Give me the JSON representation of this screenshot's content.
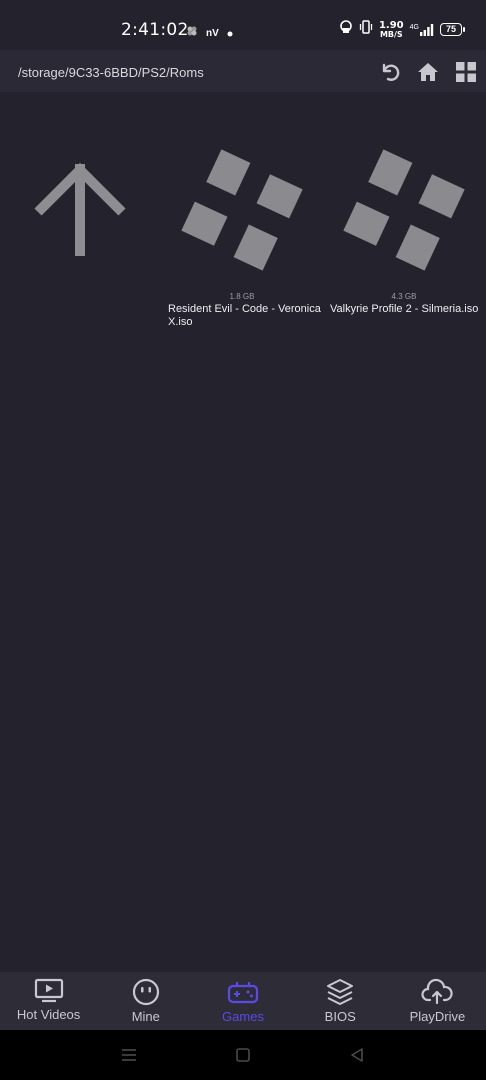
{
  "status_bar": {
    "time": "2:41:02",
    "carrier_text": "nV",
    "net_speed_value": "1.90",
    "net_speed_unit": "MB/S",
    "network_type": "4G",
    "battery": "75"
  },
  "path_header": {
    "path": "/storage/9C33-6BBD/PS2/Roms",
    "icons": [
      "back-arrow-icon",
      "home-icon",
      "grid-view-icon"
    ]
  },
  "files": [
    {
      "type": "parent-directory",
      "icon": "up-arrow-icon",
      "size": "",
      "name": ""
    },
    {
      "type": "game",
      "icon": "gamepad-dpad-icon",
      "size": "1.8 GB",
      "name": "Resident Evil - Code - Veronica X.iso"
    },
    {
      "type": "game",
      "icon": "gamepad-dpad-icon",
      "size": "4.3 GB",
      "name": "Valkyrie Profile 2 - Silmeria.iso"
    }
  ],
  "bottom_nav": {
    "items": [
      {
        "label": "Hot Videos",
        "icon": "video-tv-icon",
        "active": false
      },
      {
        "label": "Mine",
        "icon": "face-icon",
        "active": false
      },
      {
        "label": "Games",
        "icon": "gamepad-icon",
        "active": true
      },
      {
        "label": "BIOS",
        "icon": "layers-icon",
        "active": false
      },
      {
        "label": "PlayDrive",
        "icon": "cloud-upload-icon",
        "active": false
      }
    ],
    "active_color": "#5a4ae8"
  },
  "colors": {
    "background": "#24222c",
    "header": "#2b2935",
    "nav": "#2e2c37",
    "icon_gray": "#8a8a8f"
  }
}
